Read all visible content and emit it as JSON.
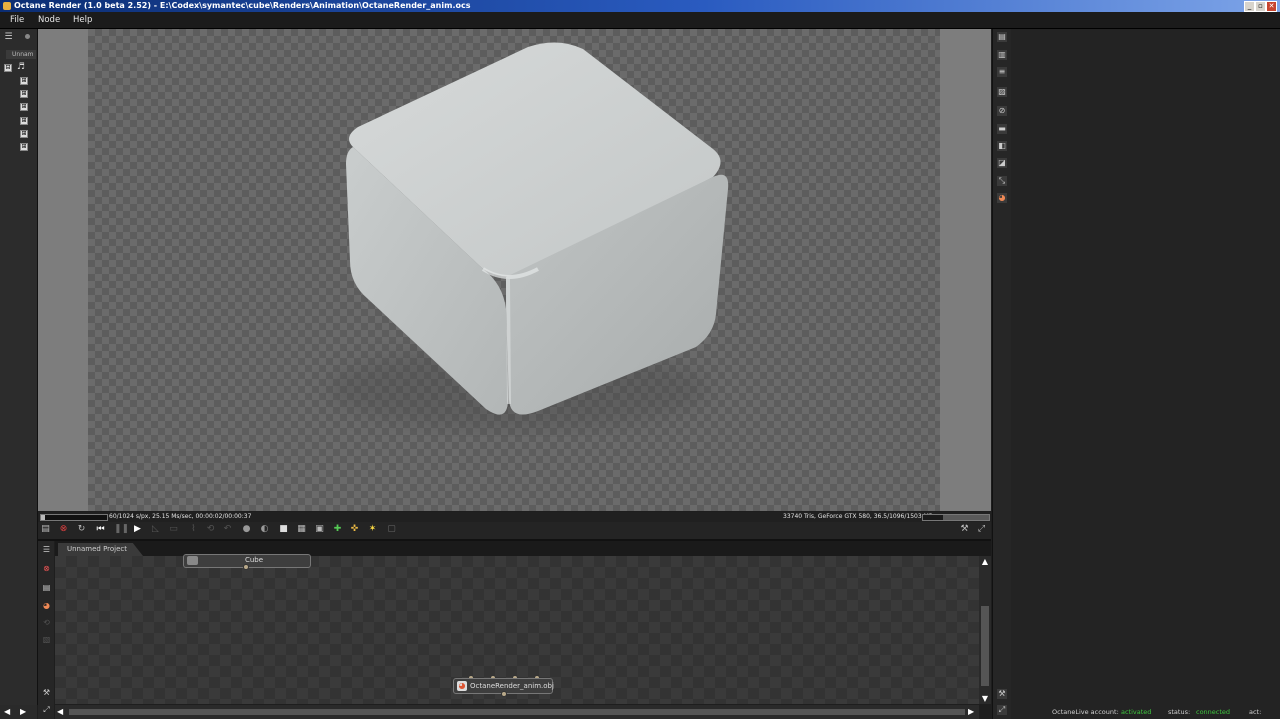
{
  "window": {
    "title": "Octane Render (1.0 beta 2.52) - E:\\Codex\\symantec\\cube\\Renders\\Animation\\OctaneRender_anim.ocs",
    "icon": "octane-app-icon",
    "controls": {
      "minimize": "_",
      "maximize": "▫",
      "close": "✕"
    }
  },
  "menu": {
    "items": [
      "File",
      "Node",
      "Help"
    ]
  },
  "scene_outliner": {
    "tab_label": "Unnam",
    "tree_expanders": [
      "⊟",
      "⊞",
      "⊞",
      "⊞",
      "⊞",
      "⊞",
      "⊞"
    ]
  },
  "viewport": {
    "stats_left": "60/1024 s/px, 25.15 Ms/sec, 00:00:02/00:00:37",
    "stats_right": "33740 Tris, GeForce GTX 580, 36.5/1096/1503 MB",
    "progress": 0.06,
    "object": "cube",
    "colors": {
      "background": "#7d7d7d",
      "cube": "#c8cccc"
    }
  },
  "render_toolbar": {
    "icons": [
      "save-render-icon",
      "stop-render-icon",
      "restart-render-icon",
      "rewind-icon",
      "pause-icon",
      "play-icon",
      "region-render-icon",
      "film-region-icon",
      "lock-icon",
      "clay-mode-icon",
      "alpha-icon",
      "subsample-icon",
      "view-icon",
      "picker-icon",
      "focus-picker-icon",
      "white-balance-icon",
      "material-picker-icon",
      "settings-icon",
      "fullscreen-icon"
    ]
  },
  "node_graph": {
    "tab_label": "Unnamed Project",
    "nodes": [
      {
        "label": "Cube"
      },
      {
        "label": "OctaneRender_anim.obj"
      }
    ]
  },
  "status": {
    "account_label": "OctaneLive account:",
    "account_value": "activated",
    "status_label": "status:",
    "status_value": "connected",
    "act_label": "act:",
    "ok_color": "#3ec43e"
  }
}
